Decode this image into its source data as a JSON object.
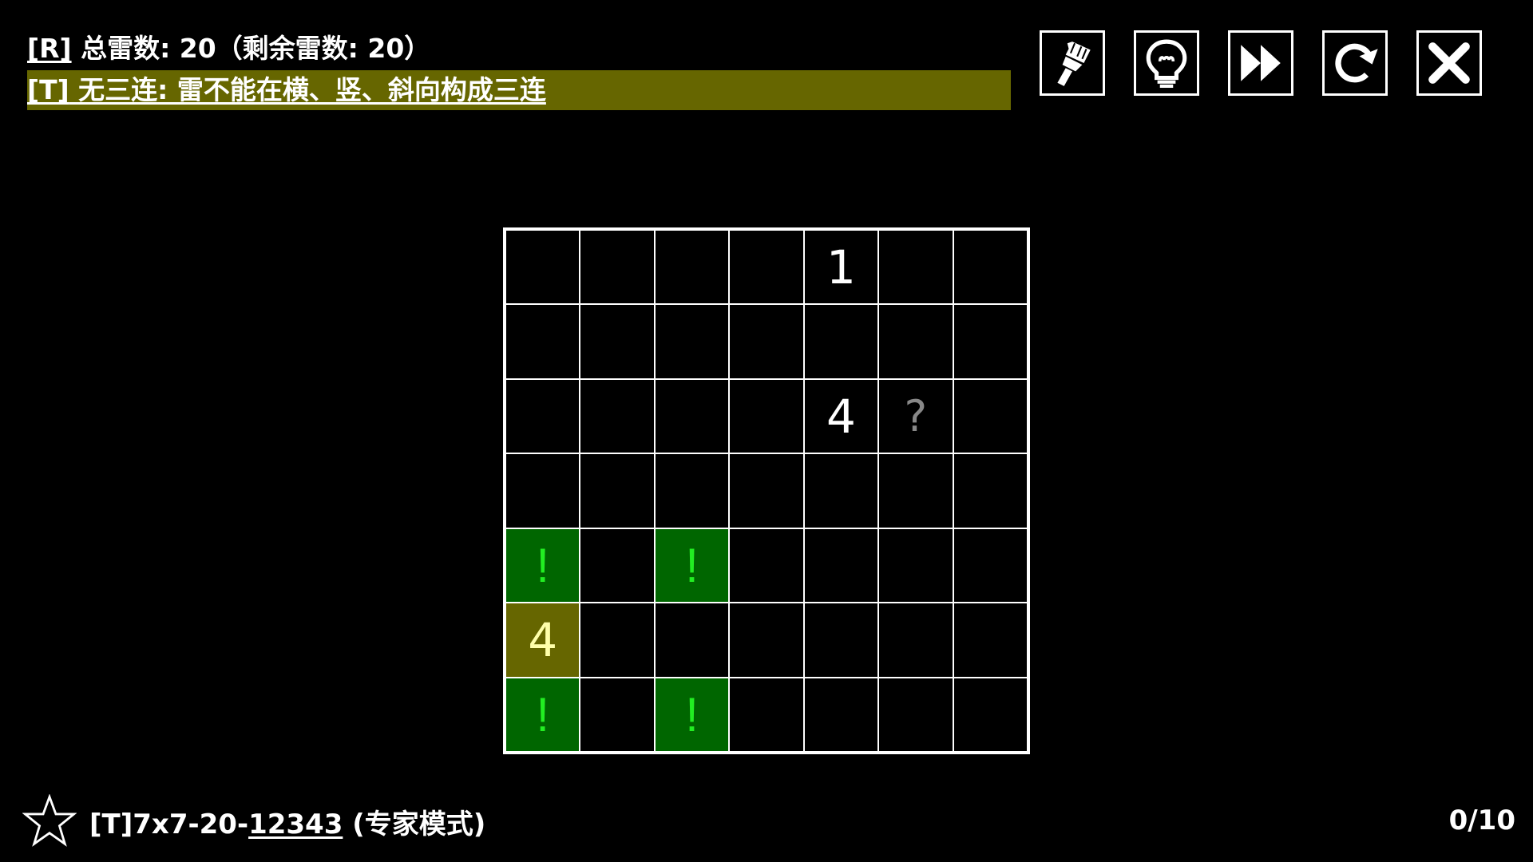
{
  "rules": {
    "total_key": "[R]",
    "total_text": " 总雷数:  20（剩余雷数: 20）",
    "active_key": "[T]",
    "active_text": " 无三连: 雷不能在横、竖、斜向构成三连"
  },
  "toolbar": {
    "brush_icon": "brush-icon",
    "hint_icon": "lightbulb-icon",
    "skip_icon": "fast-forward-icon",
    "restart_icon": "restart-icon",
    "close_icon": "close-icon"
  },
  "board": {
    "rows": 7,
    "cols": 7,
    "cells": [
      [
        "",
        "",
        "",
        "",
        "1",
        "",
        ""
      ],
      [
        "",
        "",
        "",
        "",
        "",
        "",
        ""
      ],
      [
        "",
        "",
        "",
        "",
        "4",
        "?",
        ""
      ],
      [
        "",
        "",
        "",
        "",
        "",
        "",
        ""
      ],
      [
        "!",
        "",
        "!",
        "",
        "",
        "",
        ""
      ],
      [
        "4",
        "",
        "",
        "",
        "",
        "",
        ""
      ],
      [
        "!",
        "",
        "!",
        "",
        "",
        "",
        ""
      ]
    ],
    "colors": {
      "mine_bg": "#006600",
      "mine_fg": "#22ee22",
      "highlight_bg": "#666600",
      "highlight_fg": "#ffffaa",
      "question_fg": "#888888"
    }
  },
  "footer": {
    "prefix": "[T]7x7-20-",
    "seed": "12343",
    "mode": " (专家模式)",
    "progress": "0/10"
  }
}
